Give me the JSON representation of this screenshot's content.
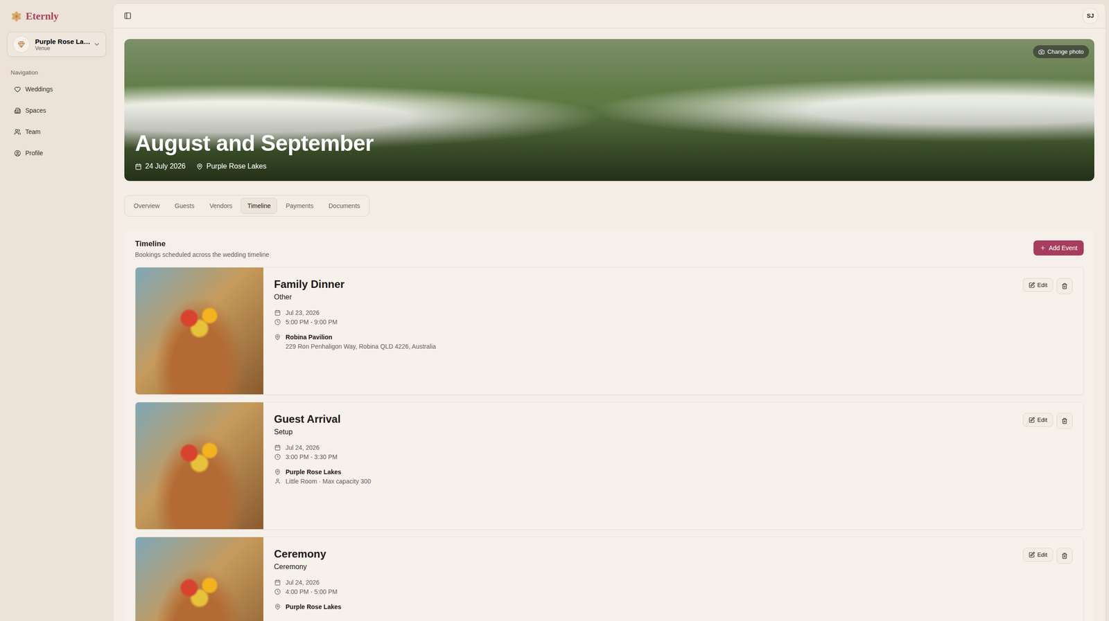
{
  "logo": {
    "text": "Eternly"
  },
  "venue_switcher": {
    "name": "Purple Rose La…",
    "role": "Venue"
  },
  "sidebar": {
    "section": "Navigation",
    "items": [
      {
        "label": "Weddings",
        "icon": "heart",
        "selected": false
      },
      {
        "label": "Spaces",
        "icon": "building",
        "selected": false
      },
      {
        "label": "Team",
        "icon": "users",
        "selected": false
      },
      {
        "label": "Profile",
        "icon": "profile",
        "selected": false
      }
    ]
  },
  "header": {
    "avatar": "SJ"
  },
  "hero": {
    "title": "August and September",
    "date": "24 July 2026",
    "location": "Purple Rose Lakes",
    "change_photo": "Change photo"
  },
  "tabs": [
    {
      "label": "Overview",
      "selected": false
    },
    {
      "label": "Guests",
      "selected": false
    },
    {
      "label": "Vendors",
      "selected": false
    },
    {
      "label": "Timeline",
      "selected": true
    },
    {
      "label": "Payments",
      "selected": false
    },
    {
      "label": "Documents",
      "selected": false
    }
  ],
  "timeline": {
    "title": "Timeline",
    "subtitle": "Bookings scheduled across the wedding timeline",
    "add_button": "Add Event",
    "events": [
      {
        "name": "Family Dinner",
        "type": "Other",
        "date": "Jul 23, 2026",
        "time": "5:00 PM - 9:00 PM",
        "venue": "Robina Pavilion",
        "detail": {
          "kind": "address",
          "text": "229 Ron Penhaligon Way, Robina QLD 4226, Australia"
        },
        "edit": "Edit"
      },
      {
        "name": "Guest Arrival",
        "type": "Setup",
        "date": "Jul 24, 2026",
        "time": "3:00 PM - 3:30 PM",
        "venue": "Purple Rose Lakes",
        "detail": {
          "kind": "room",
          "text": "Little Room · Max capacity 300"
        },
        "edit": "Edit"
      },
      {
        "name": "Ceremony",
        "type": "Ceremony",
        "date": "Jul 24, 2026",
        "time": "4:00 PM - 5:00 PM",
        "venue": "Purple Rose Lakes",
        "detail": null,
        "edit": "Edit"
      }
    ]
  }
}
